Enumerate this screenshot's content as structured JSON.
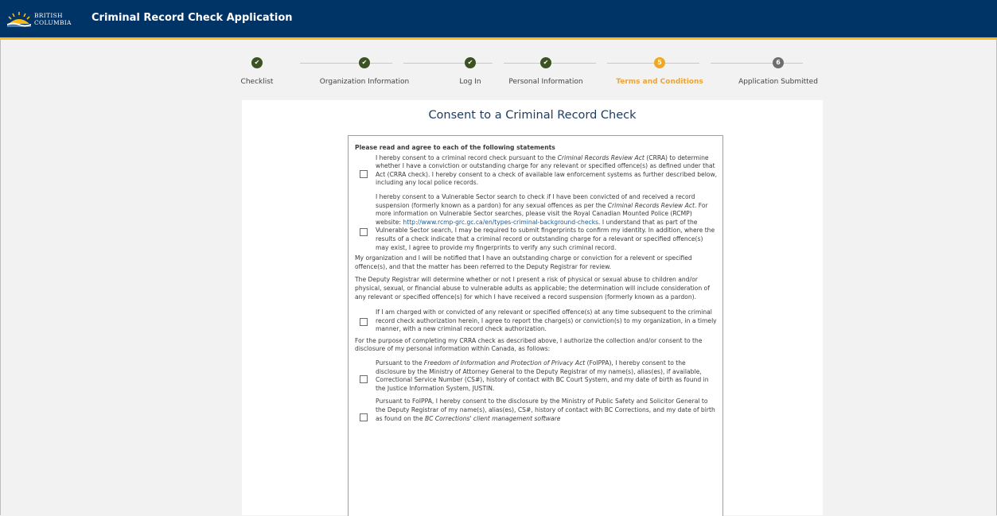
{
  "header": {
    "logo_line1": "BRITISH",
    "logo_line2": "COLUMBIA",
    "title": "Criminal Record Check Application"
  },
  "steps": [
    {
      "label": "Checklist",
      "status": "done",
      "marker": ""
    },
    {
      "label": "Organization Information",
      "status": "done",
      "marker": ""
    },
    {
      "label": "Log In",
      "status": "done",
      "marker": ""
    },
    {
      "label": "Personal Information",
      "status": "done",
      "marker": ""
    },
    {
      "label": "Terms and Conditions",
      "status": "current",
      "marker": "5"
    },
    {
      "label": "Application Submitted",
      "status": "todo",
      "marker": "6"
    }
  ],
  "consent": {
    "title": "Consent to a Criminal Record Check",
    "heading": "Please read and agree to each of the following statements",
    "item1": {
      "a": "I hereby consent to a criminal record check pursuant to the ",
      "b": "Criminal Records Review Act",
      "c": " (CRRA) to determine whether I have a conviction or outstanding charge for any relevant or specified offence(s) as defined under that Act (CRRA check). I hereby consent to a check of available law enforcement systems as further described below, including any local police records."
    },
    "item2": {
      "a": "I hereby consent to a Vulnerable Sector search to check if I have been convicted of and received a record suspension (formerly known as a pardon) for any sexual offences as per the ",
      "b": "Criminal Records Review Act",
      "c": ". For more information on Vulnerable Sector searches, please visit the Royal Canadian Mounted Police (RCMP) website: ",
      "link": "http://www.rcmp-grc.gc.ca/en/types-criminal-background-checks",
      "d": ". I understand that as part of the Vulnerable Sector search, I may be required to submit fingerprints to confirm my identity. In addition, where the results of a check indicate that a criminal record or outstanding charge for a relevant or specified offence(s) may exist, I agree to provide my fingerprints to verify any such criminal record."
    },
    "para1": "My organization and I will be notified that I have an outstanding charge or conviction for a relevent or specified offence(s), and that the matter has been referred to the Deputy Registrar for review.",
    "para2": "The Deputy Registrar will determine whether or not I present a risk of physical or sexual abuse to children and/or physical, sexual, or financial abuse to vulnerable adults as applicable; the determination will include consideration of any relevant or specified offence(s) for which I have received a record suspension (formerly known as a pardon).",
    "item3": "If I am charged with or convicted of any relevant or specified offence(s) at any time subsequent to the criminal record check authorization herein, I agree to report the charge(s) or conviction(s) to my organization, in a timely manner, with a new criminal record check authorization.",
    "para3": "For the purpose of completing my CRRA check as described above, I authorize the collection and/or consent to the disclosure of my personal information within Canada, as follows:",
    "item4": {
      "a": "Pursuant to the ",
      "b": "Freedom of Information and Protection of Privacy Act",
      "c": " (FoIPPA), I hereby consent to the disclosure by the Ministry of Attorney General to the Deputy Registrar of my name(s), alias(es), if available, Correctional Service Number (CS#), history of contact with BC Court System, and my date of birth as found in the Justice Information System, JUSTIN."
    },
    "item5": {
      "a": "Pursuant to FoIPPA, I hereby consent to the disclosure by the Ministry of Public Safety and Solicitor General to the Deputy Registrar of my name(s), alias(es), CS#, history of contact with BC Corrections, and my date of birth as found on the ",
      "b": "BC Corrections' client management software"
    }
  }
}
